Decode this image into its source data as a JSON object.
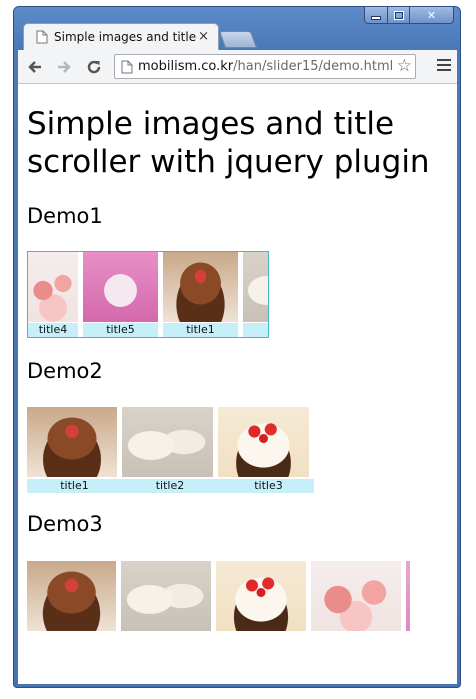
{
  "browser": {
    "tab_title": "Simple images and title",
    "tab_close": "×",
    "url_host": "mobilism.co.kr",
    "url_path": "/han/slider15/demo.html",
    "back_icon": "back-arrow-icon",
    "forward_icon": "forward-arrow-icon",
    "reload_icon": "reload-icon",
    "bookmark_icon": "star-icon",
    "menu_icon": "hamburger-menu-icon"
  },
  "page": {
    "title": "Simple images and title scroller with jquery plugin",
    "demo1": {
      "heading": "Demo1",
      "slides": [
        {
          "image": "macaron",
          "caption": "title4"
        },
        {
          "image": "pink-flower-cake",
          "caption": "title5"
        },
        {
          "image": "chocolate-cake",
          "caption": "title1"
        },
        {
          "image": "rice-cake",
          "caption": "t"
        }
      ]
    },
    "demo2": {
      "heading": "Demo2",
      "slides": [
        {
          "image": "chocolate-cake",
          "caption": "title1"
        },
        {
          "image": "rice-cake",
          "caption": "title2"
        },
        {
          "image": "strawberry-cake",
          "caption": "title3"
        }
      ]
    },
    "demo3": {
      "heading": "Demo3",
      "slides": [
        {
          "image": "chocolate-cake"
        },
        {
          "image": "rice-cake"
        },
        {
          "image": "strawberry-cake"
        },
        {
          "image": "macaron"
        },
        {
          "image": "pink-flower-cake"
        }
      ]
    }
  },
  "colors": {
    "caption_bg": "#c6effa",
    "slider_border": "#46b5c4",
    "window_frame": "#4b79b8"
  }
}
